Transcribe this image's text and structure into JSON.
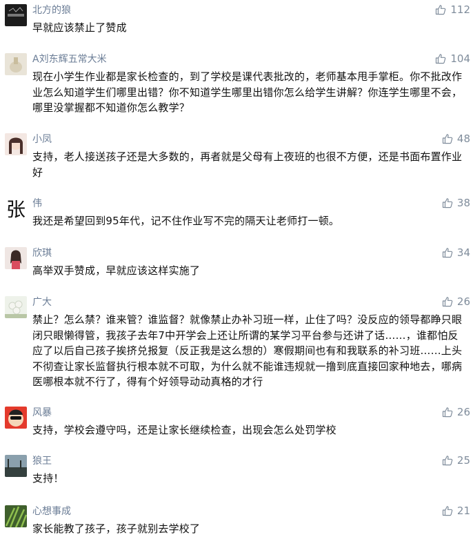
{
  "comments": [
    {
      "user": "北方的狼",
      "likes": "112",
      "text": "早就应该禁止了赞成",
      "avatar": "wolf-avatar"
    },
    {
      "user": "A刘东辉五常大米",
      "likes": "104",
      "text": "现在小学生作业都是家长检查的，到了学校是课代表批改的，老师基本甩手掌柜。你不批改作业怎么知道学生们哪里出错？你不知道学生哪里出错你怎么给学生讲解？你连学生哪里不会，哪里没掌握都不知道你怎么教学？",
      "avatar": "rice-avatar"
    },
    {
      "user": "小凤",
      "likes": "48",
      "text": "支持，老人接送孩子还是大多数的，再者就是父母有上夜班的也很不方便，还是书面布置作业好",
      "avatar": "girl-avatar"
    },
    {
      "user": "伟",
      "likes": "38",
      "text": "我还是希望回到95年代，记不住作业写不完的隔天让老师打一顿。",
      "avatar": "calligraphy-avatar",
      "avatar_char": "张"
    },
    {
      "user": "欣琪",
      "likes": "34",
      "text": "高举双手赞成，早就应该这样实施了",
      "avatar": "woman-avatar"
    },
    {
      "user": "广大",
      "likes": "26",
      "text": "禁止？怎么禁？谁来管？谁监督？就像禁止办补习班一样，止住了吗？没反应的领导都睁只眼闭只眼懒得管，我孩子去年7中开学会上还让所谓的某学习平台参与还讲了话……，谁都怕反应了以后自己孩子挨挤兑报复（反正我是这么想的）寒假期间也有和我联系的补习班……上头不彻查让家长监督执行根本就不可取，为什么就不能谁违规就一撸到底直接回家种地去，哪病医哪根本就不行了，得有个好领导动动真格的才行",
      "avatar": "flower-avatar"
    },
    {
      "user": "风暴",
      "likes": "26",
      "text": "支持，学校会遵守吗，还是让家长继续检查，出现会怎么处罚学校",
      "avatar": "cartoon-avatar"
    },
    {
      "user": "狼王",
      "likes": "25",
      "text": "支持！",
      "avatar": "landscape-avatar"
    },
    {
      "user": "心想事成",
      "likes": "21",
      "text": "家长能教了孩子，孩子就别去学校了",
      "avatar": "plant-avatar"
    }
  ]
}
